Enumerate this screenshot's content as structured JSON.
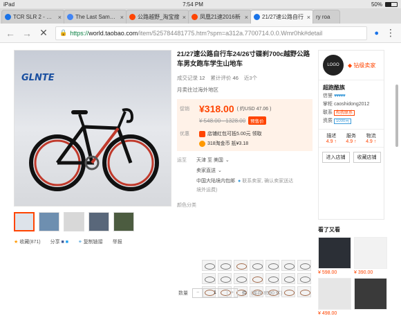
{
  "status_bar": {
    "device": "iPad",
    "time": "7:54 PM",
    "battery": "50%"
  },
  "tabs": [
    {
      "title": "TCR SLR 2 - 捷安",
      "color": "#1a73e8",
      "active": false
    },
    {
      "title": "The Last Samurai",
      "color": "#4285f4",
      "active": false
    },
    {
      "title": "公路越野_淘宝搜",
      "color": "#f40",
      "active": false
    },
    {
      "title": "凤凰21速2016新",
      "color": "#f40",
      "active": false
    },
    {
      "title": "21/27速公路自行",
      "color": "#1a73e8",
      "active": true
    }
  ],
  "tab_extra": "ry roa",
  "address": {
    "scheme": "https://",
    "host": "world.taobao.com",
    "path": "/item/525784481775.htm?spm=a312a.7700714.0.0.Wmr0hk#detail"
  },
  "product": {
    "brand_text": "GLNTE",
    "title": "21/27速公路自行车24/26寸碟刹700c越野公路车男女跑车学生山地车",
    "sales_label": "成交记录",
    "sales_count": "12",
    "reviews_label": "累计评价",
    "reviews_count": "46",
    "views": "近3个",
    "origin": "月卖往过海外地区",
    "price_label": "促销",
    "price": "¥318.00",
    "price_usd": "( 约USD 47.06 )",
    "original_price": "¥ 548.00 - 1328.00",
    "presale_tag": "预售价",
    "promo_label": "优惠",
    "promo_1": "店铺红包可抵5.00元 领取",
    "promo_2": "318淘金币 抵¥3.18",
    "ship_label": "运至",
    "ship_to": "天津 至 美国",
    "ship_method": "卖家直送",
    "ship_note": "中国大陆境内包邮",
    "ship_contact": "联系卖家, 确认卖家送达",
    "ship_note2": "境外运费)",
    "color_label": "颜色分类",
    "qty_label": "数量",
    "qty_value": "1",
    "qty_unit": "件",
    "stock": "(库存 8590 件)"
  },
  "gallery_actions": {
    "favorite": "收藏(871)",
    "share": "分享",
    "copy_link": "复制链接",
    "report": "举报"
  },
  "seller": {
    "level": "钻级卖家",
    "name": "超跑酷族",
    "credit_label": "信誉",
    "hearts": "♥♥♥♥♥",
    "contact_label": "掌柜",
    "contact": "caoshidong2012",
    "contact2_label": "联系",
    "contact2_badge": "和我联系",
    "deposit_label": "资质",
    "deposit_badge": "1000元",
    "scores_labels": [
      "描述",
      "服务",
      "物流"
    ],
    "scores": [
      "4.9 ↑",
      "4.9 ↑",
      "4.9 ↑"
    ],
    "enter_shop": "进入店铺",
    "save_shop": "收藏店铺"
  },
  "recommendations": {
    "title": "看了又看",
    "items": [
      {
        "price": "¥ 598.00"
      },
      {
        "price": "¥ 390.00"
      },
      {
        "price": "¥ 498.00"
      },
      {
        "price": ""
      }
    ]
  }
}
